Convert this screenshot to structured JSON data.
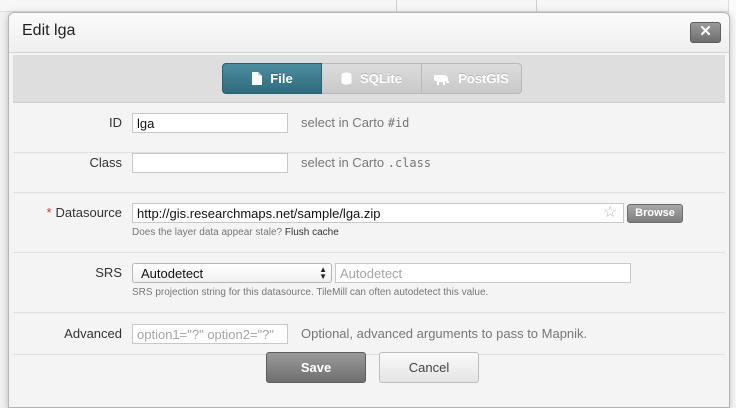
{
  "dialog": {
    "title": "Edit lga",
    "close_glyph": "✕"
  },
  "tabs": [
    {
      "label": "File",
      "icon": "file-icon",
      "active": true
    },
    {
      "label": "SQLite",
      "icon": "database-icon",
      "active": false
    },
    {
      "label": "PostGIS",
      "icon": "elephant-icon",
      "active": false
    }
  ],
  "fields": {
    "id": {
      "label": "ID",
      "value": "lga",
      "hint_prefix": "select in Carto",
      "hint_code": "#id"
    },
    "class": {
      "label": "Class",
      "value": "",
      "hint_prefix": "select in Carto",
      "hint_code": ".class"
    },
    "datasource": {
      "required_mark": "*",
      "label": "Datasource",
      "value": "http://gis.researchmaps.net/sample/lga.zip",
      "browse_label": "Browse",
      "help_text": "Does the layer data appear stale?",
      "help_link": "Flush cache"
    },
    "srs": {
      "label": "SRS",
      "select_value": "Autodetect",
      "input_placeholder": "Autodetect",
      "help_text": "SRS projection string for this datasource. TileMill can often autodetect this value."
    },
    "advanced": {
      "label": "Advanced",
      "placeholder": "option1=\"?\" option2=\"?\"",
      "hint": "Optional, advanced arguments to pass to Mapnik."
    }
  },
  "buttons": {
    "save": "Save",
    "cancel": "Cancel"
  },
  "colors": {
    "active_tab": "#3a7c8e",
    "required": "#c0392b"
  }
}
